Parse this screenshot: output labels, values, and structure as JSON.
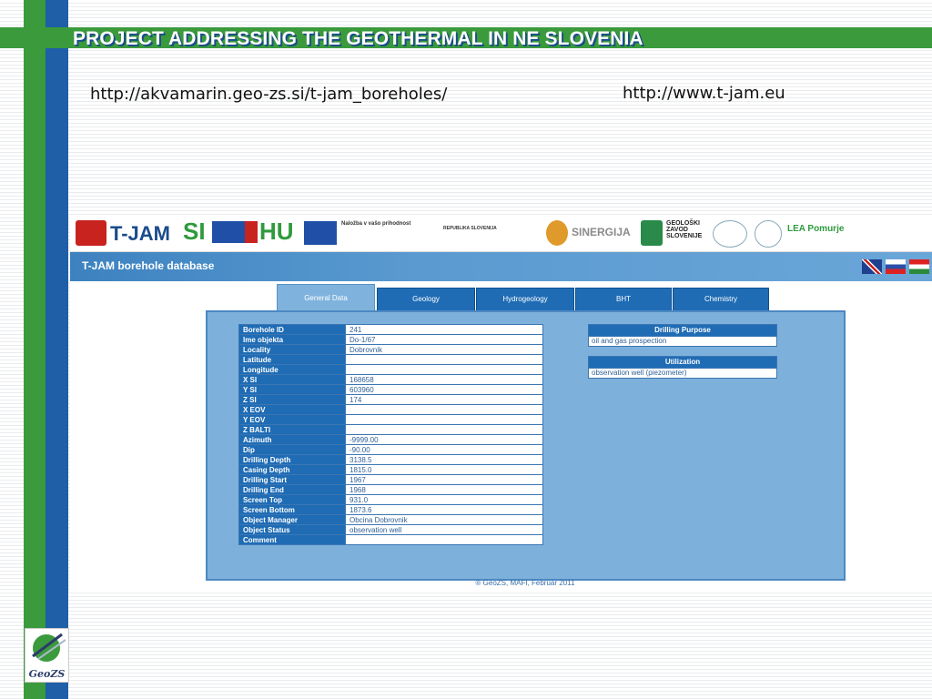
{
  "slide": {
    "title": "PROJECT ADDRESSING THE GEOTHERMAL IN NE SLOVENIA",
    "link_boreholes": "http://akvamarin.geo-zs.si/t-jam_boreholes/",
    "link_tjam": "http://www.t-jam.eu",
    "corner_logo": "GeoZS"
  },
  "logos": {
    "tjam": "T-JAM",
    "si": "SI",
    "hu": "HU",
    "nalozba": "Naložba v vašo prihodnost",
    "republika": "REPUBLIKA SLOVENIJA",
    "sinergija": "SINERGIJA",
    "geoloski": "GEOLOŠKI ZAVOD SLOVENIJE",
    "lea": "LEA Pomurje"
  },
  "app": {
    "title": "T-JAM borehole database",
    "tabs": [
      "General Data",
      "Geology",
      "Hydrogeology",
      "BHT",
      "Chemistry"
    ],
    "general": [
      {
        "label": "Borehole ID",
        "value": "241"
      },
      {
        "label": "Ime objekta",
        "value": "Do-1/67"
      },
      {
        "label": "Locality",
        "value": "Dobrovnik"
      },
      {
        "label": "Latitude",
        "value": ""
      },
      {
        "label": "Longitude",
        "value": ""
      },
      {
        "label": "X SI",
        "value": "168658"
      },
      {
        "label": "Y SI",
        "value": "603960"
      },
      {
        "label": "Z SI",
        "value": "174"
      },
      {
        "label": "X EOV",
        "value": ""
      },
      {
        "label": "Y EOV",
        "value": ""
      },
      {
        "label": "Z BALTI",
        "value": ""
      },
      {
        "label": "Azimuth",
        "value": "-9999.00"
      },
      {
        "label": "Dip",
        "value": "-90.00"
      },
      {
        "label": "Drilling Depth",
        "value": "3138.5"
      },
      {
        "label": "Casing Depth",
        "value": "1815.0"
      },
      {
        "label": "Drilling Start",
        "value": "1967"
      },
      {
        "label": "Drilling End",
        "value": "1968"
      },
      {
        "label": "Screen Top",
        "value": "931.0"
      },
      {
        "label": "Screen Bottom",
        "value": "1873.6"
      },
      {
        "label": "Object Manager",
        "value": "Obcina Dobrovnik"
      },
      {
        "label": "Object Status",
        "value": "observation well"
      },
      {
        "label": "Comment",
        "value": ""
      }
    ],
    "drilling_purpose_header": "Drilling Purpose",
    "drilling_purpose_value": "oil and gas prospection",
    "utilization_header": "Utilization",
    "utilization_value": "observation well (piezometer)",
    "footer": "® GeoZS, MAFI, Februar 2011"
  },
  "colors": {
    "accent_green": "#3a9a3c",
    "accent_blue": "#1e5fa8",
    "table_header": "#1f6cb5"
  }
}
